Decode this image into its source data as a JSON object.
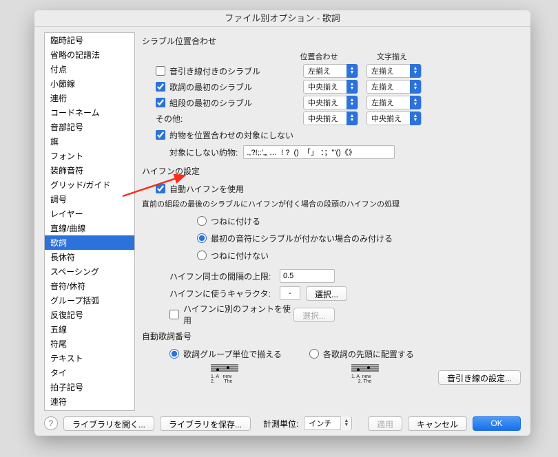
{
  "title": "ファイル別オプション - 歌詞",
  "sidebar": {
    "items": [
      {
        "label": "臨時記号"
      },
      {
        "label": "省略の記譜法"
      },
      {
        "label": "付点"
      },
      {
        "label": "小節線"
      },
      {
        "label": "連桁"
      },
      {
        "label": "コードネーム"
      },
      {
        "label": "音部記号"
      },
      {
        "label": "旗"
      },
      {
        "label": "フォント"
      },
      {
        "label": "装飾音符"
      },
      {
        "label": "グリッド/ガイド"
      },
      {
        "label": "調号"
      },
      {
        "label": "レイヤー"
      },
      {
        "label": "直線/曲線"
      },
      {
        "label": "歌詞",
        "selected": true
      },
      {
        "label": "長休符"
      },
      {
        "label": "スペーシング"
      },
      {
        "label": "音符/休符"
      },
      {
        "label": "グループ括弧"
      },
      {
        "label": "反復記号"
      },
      {
        "label": "五線"
      },
      {
        "label": "符尾"
      },
      {
        "label": "テキスト"
      },
      {
        "label": "タイ"
      },
      {
        "label": "拍子記号"
      },
      {
        "label": "連符"
      }
    ]
  },
  "syllable_alignment": {
    "title": "シラブル位置合わせ",
    "col1": "位置合わせ",
    "col2": "文字揃え",
    "rows": [
      {
        "label": "音引き線付きのシラブル",
        "checked": false,
        "v1": "左揃え",
        "v2": "左揃え"
      },
      {
        "label": "歌詞の最初のシラブル",
        "checked": true,
        "v1": "中央揃え",
        "v2": "左揃え"
      },
      {
        "label": "組段の最初のシラブル",
        "checked": true,
        "v1": "中央揃え",
        "v2": "左揃え"
      }
    ],
    "other_label": "その他:",
    "other_v1": "中央揃え",
    "other_v2": "中央揃え",
    "exclude_label": "約物を位置合わせの対象にしない",
    "exclude_checked": true,
    "exclude_chars_label": "対象にしない約物:",
    "exclude_chars_value": ".,?!;:'‚„ …  ! ?  ()  「」 ：；\"'()《》"
  },
  "hyphen": {
    "title": "ハイフンの設定",
    "auto_label": "自動ハイフンを使用",
    "auto_checked": true,
    "desc": "直前の組段の最後のシラブルにハイフンが付く場合の段頭のハイフンの処理",
    "opt1": "つねに付ける",
    "opt2": "最初の音符にシラブルが付かない場合のみ付ける",
    "opt3": "つねに付けない",
    "selected": "opt2",
    "spacing_label": "ハイフン同士の間隔の上限:",
    "spacing_value": "0.5",
    "char_label": "ハイフンに使うキャラクタ:",
    "char_value": "-",
    "choose": "選択...",
    "font_label": "ハイフンに別のフォントを使用",
    "font_checked": false
  },
  "numbering": {
    "title": "自動歌詞番号",
    "opt1": "歌詞グループ単位で揃える",
    "opt2": "各歌詞の先頭に配置する",
    "selected": "opt1",
    "preview1": "1. A   new\n2.       The",
    "preview2": "1. A  new\n     2. The",
    "ext_btn": "音引き線の設定..."
  },
  "footer": {
    "open": "ライブラリを開く...",
    "save": "ライブラリを保存...",
    "unit_label": "計測単位:",
    "unit_value": "インチ",
    "apply": "適用",
    "cancel": "キャンセル",
    "ok": "OK"
  }
}
